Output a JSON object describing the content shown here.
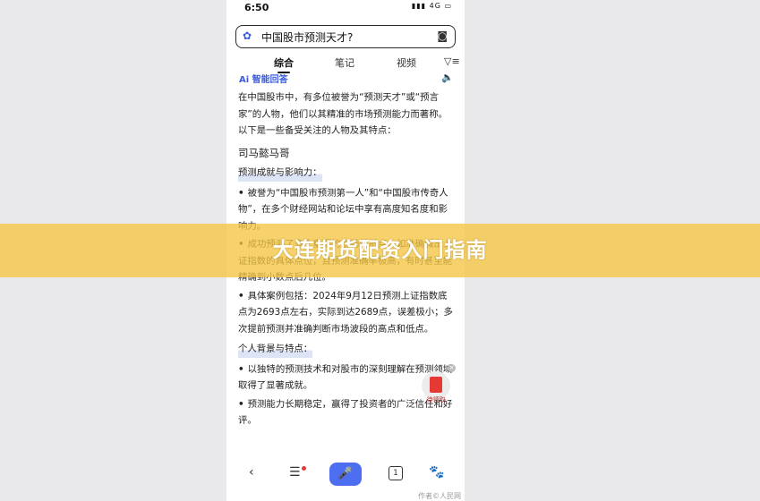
{
  "status_bar": {
    "time": "6:50",
    "indicators": "▮▮▮ 4G ▭"
  },
  "search": {
    "query": "中国股市预测天才?",
    "logo_icon": "paw-icon",
    "camera_icon": "camera-icon"
  },
  "tabs": [
    {
      "label": "综合",
      "active": true
    },
    {
      "label": "笔记",
      "active": false
    },
    {
      "label": "视频",
      "active": false
    },
    {
      "label": "▽≡",
      "active": false
    }
  ],
  "ai_header": {
    "label": "Ai 智能回答"
  },
  "content": {
    "intro": "在中国股市中，有多位被誉为“预测天才”或“预言家”的人物，他们以其精准的市场预测能力而著称。以下是一些备受关注的人物及其特点：",
    "name": "司马懿马哥",
    "section1_title": "预测成就与影响力：",
    "bullet1": "被誉为“中国股市预测第一人”和“中国股市传奇人物”，在多个财经网站和论坛中享有高度知名度和影响力。",
    "bullet2": "成功预测了多个重要的市场转折点，如准确喊出上证指数的具体点位，且预测准确率极高，有时甚至能精确到小数点后几位。",
    "bullet3": "具体案例包括：2024年9月12日预测上证指数底点为2693点左右，实际到达2689点，误差极小；多次提前预测并准确判断市场波段的高点和低点。",
    "section2_title": "个人背景与特点：",
    "bullet4": "以独特的预测技术和对股市的深刻理解在预测领域取得了显著成就。",
    "bullet5": "预测能力长期稳定，赢得了投资者的广泛信任和好评。"
  },
  "redpacket": {
    "label": "待领取"
  },
  "bottom_nav": {
    "back": "‹",
    "menu": "☰",
    "mic": "🎤",
    "tab_count": "1",
    "home": "🐾"
  },
  "watermark": "作者©人民网",
  "banner": {
    "title": "大连期货配资入门指南",
    "color": "#f5c542"
  }
}
